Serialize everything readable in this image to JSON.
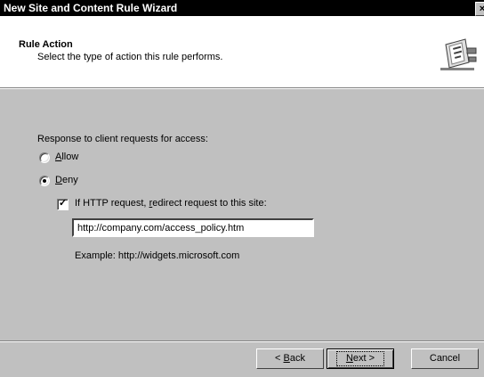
{
  "window": {
    "title": "New Site and Content Rule Wizard",
    "close_glyph": "×"
  },
  "header": {
    "title": "Rule Action",
    "subtitle": "Select the type of action this rule performs.",
    "icon": "wizard-document-icon"
  },
  "form": {
    "group_label": "Response to client requests for access:",
    "allow_label": "Allow",
    "allow_selected": false,
    "deny_label": "Deny",
    "deny_selected": true,
    "redirect_label": "If HTTP request, redirect request to this site:",
    "redirect_checked": true,
    "redirect_url": "http://company.com/access_policy.htm",
    "example": "Example: http://widgets.microsoft.com"
  },
  "buttons": {
    "back": "< Back",
    "next": "Next >",
    "cancel": "Cancel"
  }
}
